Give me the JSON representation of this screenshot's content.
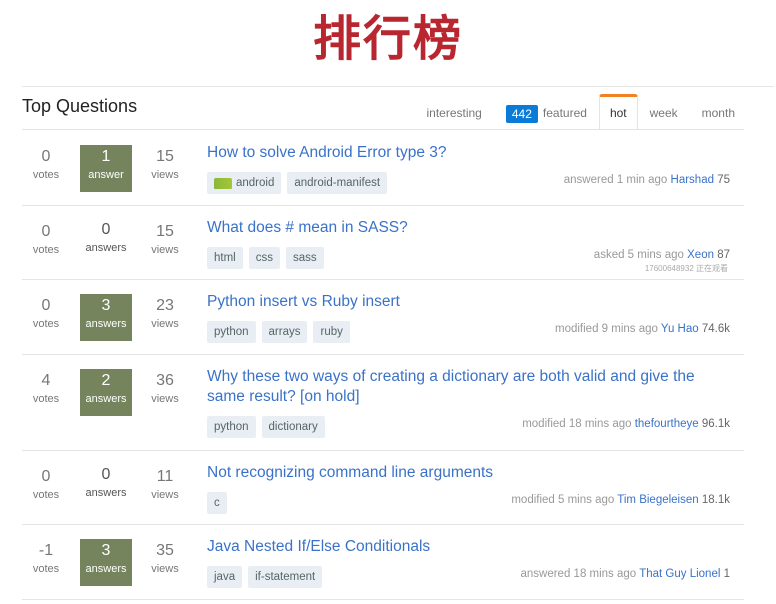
{
  "banner": {
    "title": "排行榜"
  },
  "header": {
    "title": "Top Questions",
    "tabs": [
      {
        "label": "interesting"
      },
      {
        "label": "featured",
        "badge": "442"
      },
      {
        "label": "hot",
        "active": true
      },
      {
        "label": "week"
      },
      {
        "label": "month"
      }
    ]
  },
  "colors": {
    "accepted_bg": "#75845c",
    "link": "#3a72c8",
    "badge": "#0a7bd6",
    "banner": "#b8262f",
    "active_tab": "#f48024"
  },
  "questions": [
    {
      "votes": "0",
      "votes_label": "votes",
      "answers": "1",
      "answers_label": "answer",
      "accepted": true,
      "views": "15",
      "views_label": "views",
      "title": "How to solve Android Error type 3?",
      "tags": [
        "android",
        "android-manifest"
      ],
      "action": "answered 1 min ago",
      "user": "Harshad",
      "rep": "75"
    },
    {
      "votes": "0",
      "votes_label": "votes",
      "answers": "0",
      "answers_label": "answers",
      "accepted": false,
      "views": "15",
      "views_label": "views",
      "title": "What does # mean in SASS?",
      "tags": [
        "html",
        "css",
        "sass"
      ],
      "action": "asked 5 mins ago",
      "user": "Xeon",
      "rep": "87",
      "watermark": "17600648932 正在观看"
    },
    {
      "votes": "0",
      "votes_label": "votes",
      "answers": "3",
      "answers_label": "answers",
      "accepted": true,
      "views": "23",
      "views_label": "views",
      "title": "Python insert vs Ruby insert",
      "tags": [
        "python",
        "arrays",
        "ruby"
      ],
      "action": "modified 9 mins ago",
      "user": "Yu Hao",
      "rep": "74.6k"
    },
    {
      "votes": "4",
      "votes_label": "votes",
      "answers": "2",
      "answers_label": "answers",
      "accepted": true,
      "views": "36",
      "views_label": "views",
      "title": "Why these two ways of creating a dictionary are both valid and give the same result? [on hold]",
      "tags": [
        "python",
        "dictionary"
      ],
      "action": "modified 18 mins ago",
      "user": "thefourtheye",
      "rep": "96.1k"
    },
    {
      "votes": "0",
      "votes_label": "votes",
      "answers": "0",
      "answers_label": "answers",
      "accepted": false,
      "views": "11",
      "views_label": "views",
      "title": "Not recognizing command line arguments",
      "tags": [
        "c"
      ],
      "action": "modified 5 mins ago",
      "user": "Tim Biegeleisen",
      "rep": "18.1k"
    },
    {
      "votes": "-1",
      "votes_label": "votes",
      "answers": "3",
      "answers_label": "answers",
      "accepted": true,
      "views": "35",
      "views_label": "views",
      "title": "Java Nested If/Else Conditionals",
      "tags": [
        "java",
        "if-statement"
      ],
      "action": "answered 18 mins ago",
      "user": "That Guy Lionel",
      "rep": "1"
    }
  ]
}
